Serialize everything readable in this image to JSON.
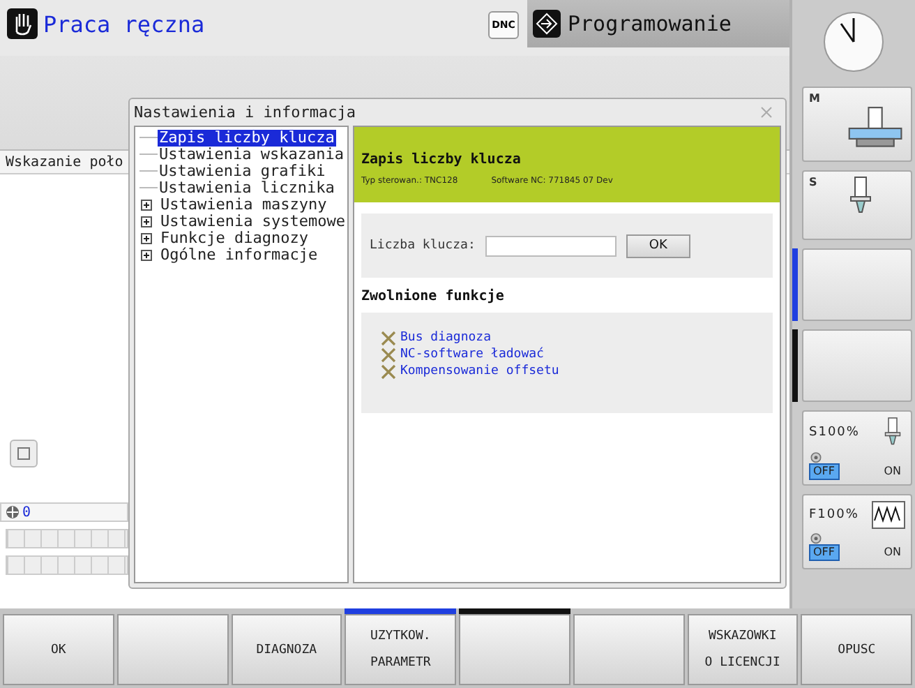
{
  "header": {
    "mode": "Praca ręczna",
    "dnc": "DNC",
    "program_tab": "Programowanie"
  },
  "background": {
    "position_label": "Wskazanie poło",
    "status_value": "0"
  },
  "dialog": {
    "title": "Nastawienia i informacja",
    "tree": [
      {
        "label": "Zapis liczby klucza",
        "kind": "leaf",
        "selected": true
      },
      {
        "label": "Ustawienia wskazania",
        "kind": "leaf",
        "selected": false
      },
      {
        "label": "Ustawienia grafiki",
        "kind": "leaf",
        "selected": false
      },
      {
        "label": "Ustawienia licznika",
        "kind": "leaf",
        "selected": false
      },
      {
        "label": "Ustawienia maszyny",
        "kind": "folder",
        "expanded": false,
        "selected": false
      },
      {
        "label": "Ustawienia systemowe",
        "kind": "folder",
        "expanded": false,
        "selected": false
      },
      {
        "label": "Funkcje diagnozy",
        "kind": "folder",
        "expanded": false,
        "selected": false
      },
      {
        "label": "Ogólne informacje",
        "kind": "folder",
        "expanded": false,
        "selected": false
      }
    ],
    "banner": {
      "title": "Zapis liczby klucza",
      "control_type": "Typ sterowan.: TNC128",
      "software": "Software NC: 771845 07 Dev"
    },
    "key_field": {
      "label": "Liczba klucza:",
      "button": "OK"
    },
    "enabled_title": "Zwolnione funkcje",
    "enabled": [
      "Bus diagnoza",
      "NC-software ładować",
      "Kompensowanie offsetu"
    ]
  },
  "side_keys": [
    {
      "kind": "clock"
    },
    {
      "kind": "machine",
      "label": "M"
    },
    {
      "kind": "spindle",
      "label": "S"
    },
    {
      "kind": "blank",
      "color": "#1f3fe0"
    },
    {
      "kind": "blank",
      "color": "#111111"
    },
    {
      "kind": "spindle_override",
      "label": "S100%",
      "switch": [
        {
          "label": "OFF",
          "selected": true
        },
        {
          "label": "ON",
          "selected": false
        }
      ]
    },
    {
      "kind": "feed_override",
      "label": "F100%",
      "switch": [
        {
          "label": "OFF",
          "selected": true
        },
        {
          "label": "ON",
          "selected": false
        }
      ]
    }
  ],
  "softkeys": [
    {
      "kind": "text",
      "lines": [
        "OK"
      ]
    },
    {
      "kind": "blank"
    },
    {
      "kind": "text",
      "lines": [
        "DIAGNOZA"
      ]
    },
    {
      "kind": "text",
      "lines": [
        "UZYTKOW.",
        "PARAMETR"
      ],
      "color": "#1f3fe0"
    },
    {
      "kind": "blank",
      "color": "#111111"
    },
    {
      "kind": "blank"
    },
    {
      "kind": "text",
      "lines": [
        "WSKAZOWKI",
        "O LICENCJI"
      ]
    },
    {
      "kind": "text",
      "lines": [
        "OPUSC"
      ]
    }
  ]
}
